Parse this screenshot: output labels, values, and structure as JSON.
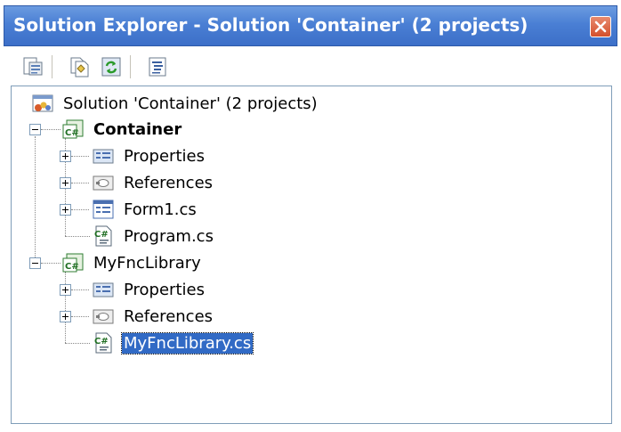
{
  "window": {
    "title": "Solution Explorer - Solution 'Container' (2 projects)",
    "title_bar_color": "#4a7fd4",
    "close_icon": "close-icon"
  },
  "toolbar": {
    "buttons": [
      {
        "name": "properties-button",
        "icon": "properties-icon"
      },
      {
        "name": "show-all-files-button",
        "icon": "show-all-files-icon"
      },
      {
        "name": "refresh-button",
        "icon": "refresh-icon"
      },
      {
        "name": "view-code-button",
        "icon": "view-code-icon"
      }
    ]
  },
  "tree": {
    "solution": {
      "label": "Solution 'Container' (2 projects)",
      "icon": "solution-icon"
    },
    "projects": [
      {
        "label": "Container",
        "bold": true,
        "expanded": true,
        "icon": "csharp-project-icon",
        "items": [
          {
            "label": "Properties",
            "icon": "properties-folder-icon",
            "expandable": true
          },
          {
            "label": "References",
            "icon": "references-icon",
            "expandable": true
          },
          {
            "label": "Form1.cs",
            "icon": "form-icon",
            "expandable": true
          },
          {
            "label": "Program.cs",
            "icon": "csharp-file-icon",
            "expandable": false
          }
        ]
      },
      {
        "label": "MyFncLibrary",
        "bold": false,
        "expanded": true,
        "icon": "csharp-project-icon",
        "items": [
          {
            "label": "Properties",
            "icon": "properties-folder-icon",
            "expandable": true
          },
          {
            "label": "References",
            "icon": "references-icon",
            "expandable": true
          },
          {
            "label": "MyFncLibrary.cs",
            "icon": "csharp-file-icon",
            "expandable": false,
            "selected": true
          }
        ]
      }
    ]
  },
  "colors": {
    "selection": "#316ac5",
    "tree_border": "#7f9db9"
  }
}
